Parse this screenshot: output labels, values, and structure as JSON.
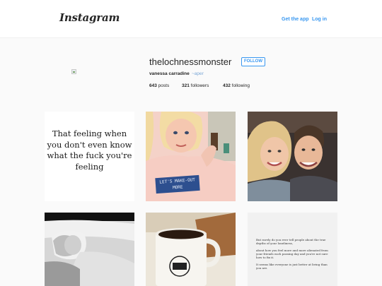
{
  "header": {
    "logo": "Instagram",
    "get_app": "Get the app",
    "login": "Log in"
  },
  "profile": {
    "username": "thelochnessmonster",
    "follow_label": "FOLLOW",
    "full_name": "vanessa carradine",
    "bio": "~aper",
    "posts_count": "643",
    "posts_label": "posts",
    "followers_count": "321",
    "followers_label": "followers",
    "following_count": "432",
    "following_label": "following"
  },
  "posts": {
    "quote_1": "That feeling when you don't even know what the fuck you're feeling",
    "shirt_text": "LET'S MAKE-OUT MORE",
    "text_post_p1": "But rarely do you ever tell people about the true depths of your loneliness,",
    "text_post_p2": "about how you feel more and more alienated from your friends each passing day and you're not sure how to fix it.",
    "text_post_p3": "It seems like everyone is just better at living than you are."
  },
  "colors": {
    "link": "#3897f0",
    "bio_link": "#7aa7d6",
    "shirt": "#2d4f8f"
  }
}
